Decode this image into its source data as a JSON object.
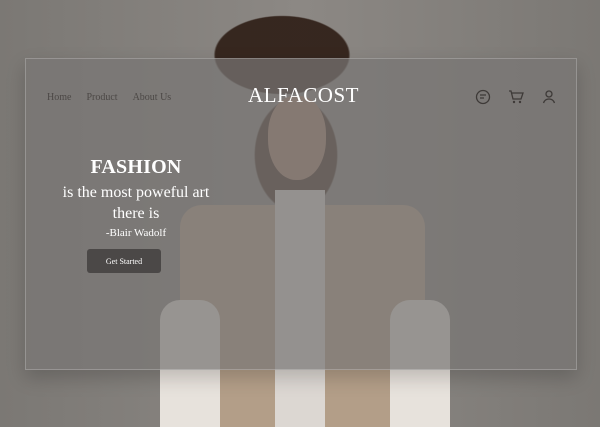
{
  "nav": {
    "links": [
      "Home",
      "Product",
      "About Us"
    ],
    "brand": "ALFACOST"
  },
  "icons": {
    "chat": "chat-icon",
    "cart": "cart-icon",
    "user": "user-icon"
  },
  "hero": {
    "headline": "FASHION",
    "quote_line1": "is the most poweful art",
    "quote_line2": "there is",
    "author": "-Blair Wadolf",
    "cta": "Get Started"
  }
}
